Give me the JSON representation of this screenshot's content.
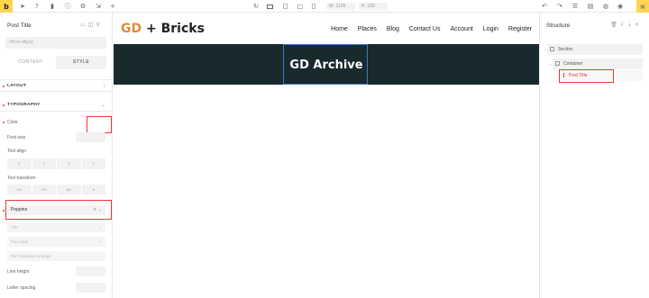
{
  "topbar": {
    "logo": "b",
    "icons": [
      "cursor-icon",
      "help-icon",
      "page-icon",
      "info-icon",
      "gear-icon",
      "export-icon",
      "plus-icon",
      "refresh-icon"
    ],
    "width_label": "W",
    "width_value": "1126",
    "height_label": "H",
    "height_value": "100",
    "save_icon": "save-icon"
  },
  "left_panel": {
    "title": "Post Title",
    "css_id": "#brxe-dfgzjc",
    "tabs": [
      "CONTENT",
      "STYLE"
    ],
    "sections": {
      "layout": "LAYOUT",
      "typography": "TYPOGRAPHY"
    },
    "controls": {
      "color": "Color",
      "font_size": "Font size",
      "text_align": "Text align",
      "text_transform": "Text transform",
      "font_family": "Poppins",
      "font_weight": "700",
      "font_style": "Font style",
      "font_variation": "Font-variation-settings",
      "line_height": "Line height",
      "letter_spacing": "Letter spacing"
    },
    "text_transform_options": [
      "Aa",
      "AA",
      "aa",
      "a"
    ]
  },
  "canvas": {
    "logo_gd": "GD",
    "logo_rest": " + Bricks",
    "nav": [
      "Home",
      "Places",
      "Blog",
      "Contact Us",
      "Account",
      "Login",
      "Register"
    ],
    "hero_title": "GD Archive"
  },
  "structure": {
    "title": "Structure",
    "items": [
      {
        "label": "Section"
      },
      {
        "label": "Container"
      },
      {
        "label": "Post Title"
      }
    ]
  },
  "colors": {
    "accent": "#ffd54f",
    "selection_red": "#e53935",
    "hero_bg": "#182a2e",
    "logo_orange": "#e08a3a"
  }
}
